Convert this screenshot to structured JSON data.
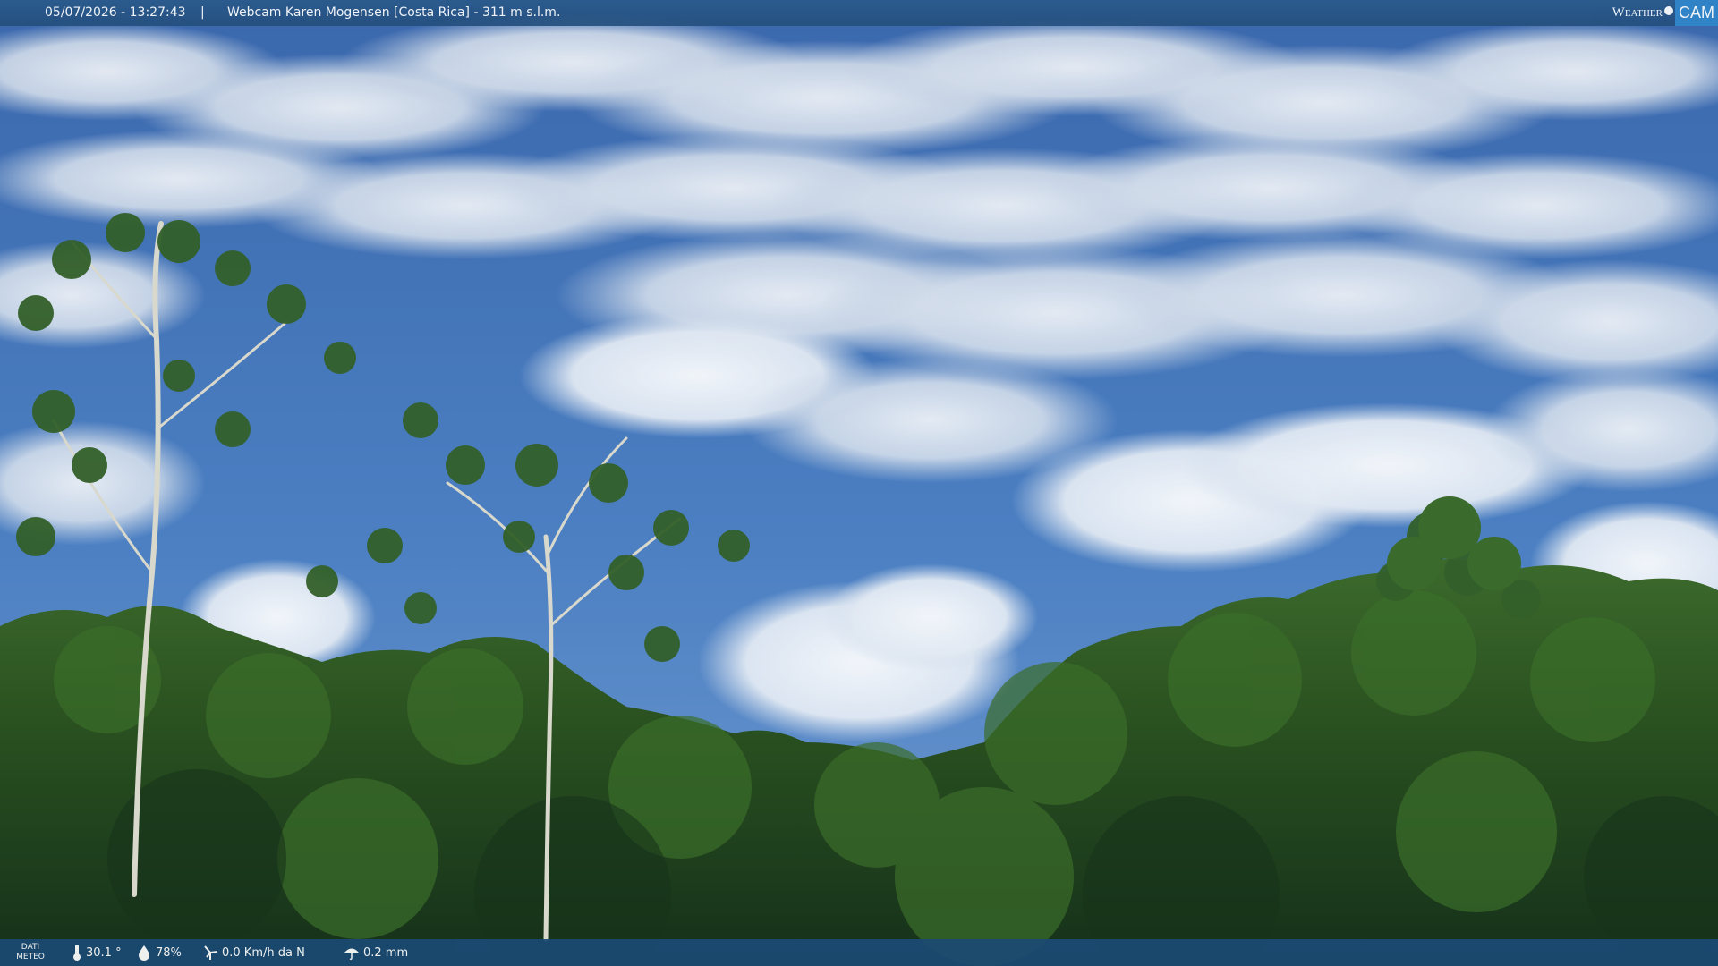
{
  "header": {
    "timestamp": "05/07/2026 - 13:27:43",
    "separator": "|",
    "camera_title": "Webcam Karen Mogensen [Costa Rica]  - 311 m s.l.m."
  },
  "logo": {
    "word": "Weather",
    "cam": "CAM"
  },
  "footer": {
    "dati_line1": "DATI",
    "dati_line2": "METEO",
    "temperature": "30.1 °",
    "humidity": "78%",
    "wind": "0.0 Km/h da N",
    "rain": "0.2 mm"
  },
  "colors": {
    "sky": "#3d6fb3",
    "cloud": "#e8edf3",
    "forest": "#24461c",
    "bar": "#1b4a74",
    "logo_accent": "#2f86c9"
  }
}
